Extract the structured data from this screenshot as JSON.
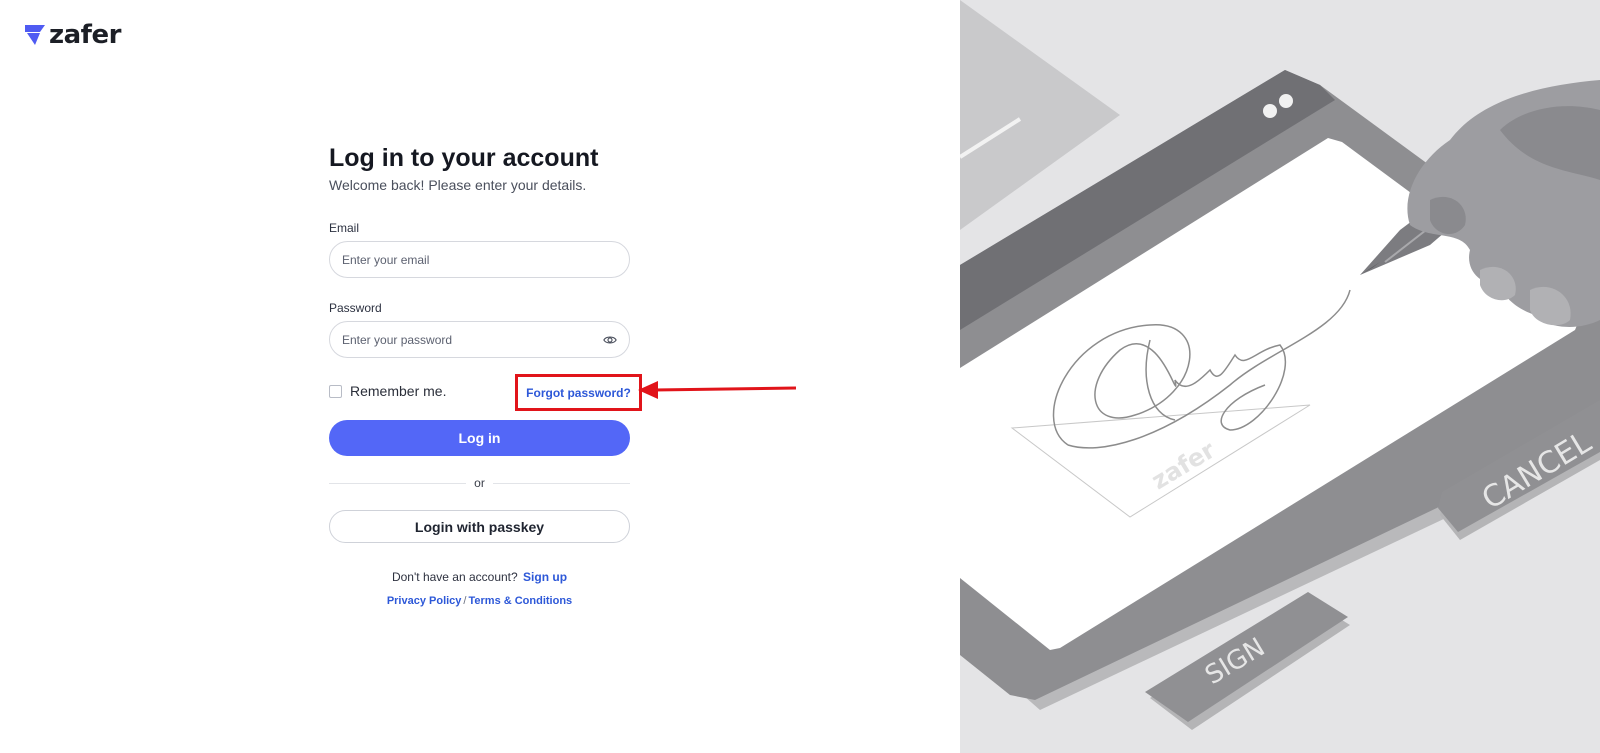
{
  "brand": {
    "name": "zafer",
    "accent_color": "#4f5bf2"
  },
  "form": {
    "title": "Log in to your account",
    "subtitle": "Welcome back! Please enter your details.",
    "email": {
      "label": "Email",
      "placeholder": "Enter your email",
      "value": ""
    },
    "password": {
      "label": "Password",
      "placeholder": "Enter your password",
      "value": ""
    },
    "remember_label": "Remember me.",
    "remember_checked": false,
    "forgot_label": "Forgot password?",
    "login_label": "Log in",
    "divider_label": "or",
    "passkey_label": "Login with passkey",
    "signup_prompt": "Don't have an account?",
    "signup_label": "Sign up",
    "privacy_label": "Privacy Policy",
    "legal_separator": "/",
    "terms_label": "Terms & Conditions"
  },
  "illustration": {
    "sign_button_label": "SIGN",
    "cancel_button_label": "CANCEL",
    "watermark": "zafer"
  },
  "annotation": {
    "highlight_color": "#e1141a"
  },
  "icons": {
    "password_toggle": "eye-icon",
    "logo": "zafer-logo-mark"
  }
}
